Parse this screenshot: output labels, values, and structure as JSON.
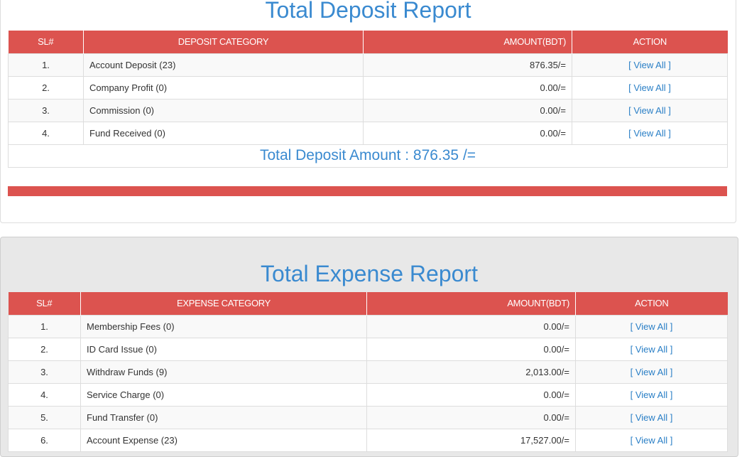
{
  "deposit": {
    "title": "Total Deposit Report",
    "headers": {
      "sl": "SL#",
      "category": "DEPOSIT CATEGORY",
      "amount": "AMOUNT(BDT)",
      "action": "ACTION"
    },
    "rows": [
      {
        "sl": "1.",
        "category": "Account Deposit (23)",
        "amount": "876.35/=",
        "action": "[ View All ]"
      },
      {
        "sl": "2.",
        "category": "Company Profit (0)",
        "amount": "0.00/=",
        "action": "[ View All ]"
      },
      {
        "sl": "3.",
        "category": "Commission (0)",
        "amount": "0.00/=",
        "action": "[ View All ]"
      },
      {
        "sl": "4.",
        "category": "Fund Received (0)",
        "amount": "0.00/=",
        "action": "[ View All ]"
      }
    ],
    "total_label": "Total Deposit Amount : 876.35 /="
  },
  "expense": {
    "title": "Total Expense Report",
    "headers": {
      "sl": "SL#",
      "category": "EXPENSE CATEGORY",
      "amount": "AMOUNT(BDT)",
      "action": "ACTION"
    },
    "rows": [
      {
        "sl": "1.",
        "category": "Membership Fees (0)",
        "amount": "0.00/=",
        "action": "[ View All ]"
      },
      {
        "sl": "2.",
        "category": "ID Card Issue (0)",
        "amount": "0.00/=",
        "action": "[ View All ]"
      },
      {
        "sl": "3.",
        "category": "Withdraw Funds (9)",
        "amount": "2,013.00/=",
        "action": "[ View All ]"
      },
      {
        "sl": "4.",
        "category": "Service Charge (0)",
        "amount": "0.00/=",
        "action": "[ View All ]"
      },
      {
        "sl": "5.",
        "category": "Fund Transfer (0)",
        "amount": "0.00/=",
        "action": "[ View All ]"
      },
      {
        "sl": "6.",
        "category": "Account Expense (23)",
        "amount": "17,527.00/=",
        "action": "[ View All ]"
      }
    ]
  },
  "colors": {
    "header_red": "#dc534f",
    "title_blue": "#3a8ad0",
    "link_blue": "#2a7fc6"
  }
}
